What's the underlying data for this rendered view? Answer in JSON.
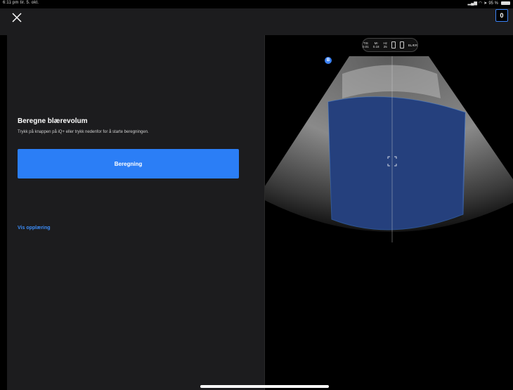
{
  "status": {
    "time": "6:11 pm",
    "date": "tir. 5. okt.",
    "battery": "95 %"
  },
  "topbar": {
    "count": "0"
  },
  "panel": {
    "title": "Beregne blærevolum",
    "subtitle": "Trykk på knappen på iQ+ eller trykk nedenfor for å starte beregningen.",
    "button": "Beregning",
    "link": "Vis opplæring"
  },
  "scan": {
    "params": {
      "tis_label": "TIS",
      "tis": "0.01",
      "mi_label": "MI",
      "mi": "0.18",
      "hz_label": "Hz",
      "hz": "25",
      "preset": "BLÆR"
    },
    "marker": "B"
  },
  "colors": {
    "accent": "#2b7ef6",
    "panel": "#1c1c1e",
    "overlay": "#2f5fcf"
  }
}
